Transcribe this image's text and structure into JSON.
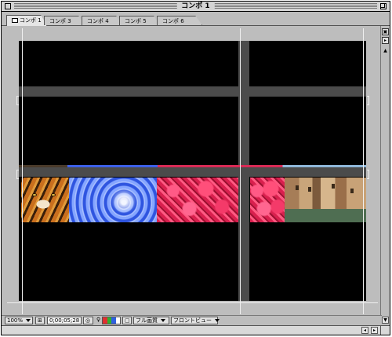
{
  "window": {
    "title": "コンポ 1"
  },
  "tabs": [
    {
      "label": "コンポ 1",
      "active": true,
      "has_icon": true
    },
    {
      "label": "コンポ 3",
      "active": false
    },
    {
      "label": "コンポ 4",
      "active": false
    },
    {
      "label": "コンポ 5",
      "active": false
    },
    {
      "label": "コンポ 6",
      "active": false
    }
  ],
  "right_controls": {
    "flowchart_icon": "flowchart-icon",
    "menu_arrow_icon": "triangle-right-icon"
  },
  "comp_panel": {
    "background_color": "#000000",
    "grid_bar_color": "#4b4b4b",
    "image_strip": [
      "tiger",
      "blue-abstract",
      "pink-flowers",
      "pink-flowers",
      "venice-canal"
    ]
  },
  "bottom_bar": {
    "zoom": "100%",
    "timecode": "0;00;05;28",
    "quality": "フル画質",
    "view": "フロントビュー",
    "channel_colors": [
      "#e03030",
      "#30b030",
      "#3060e0",
      "#ffffff"
    ]
  }
}
